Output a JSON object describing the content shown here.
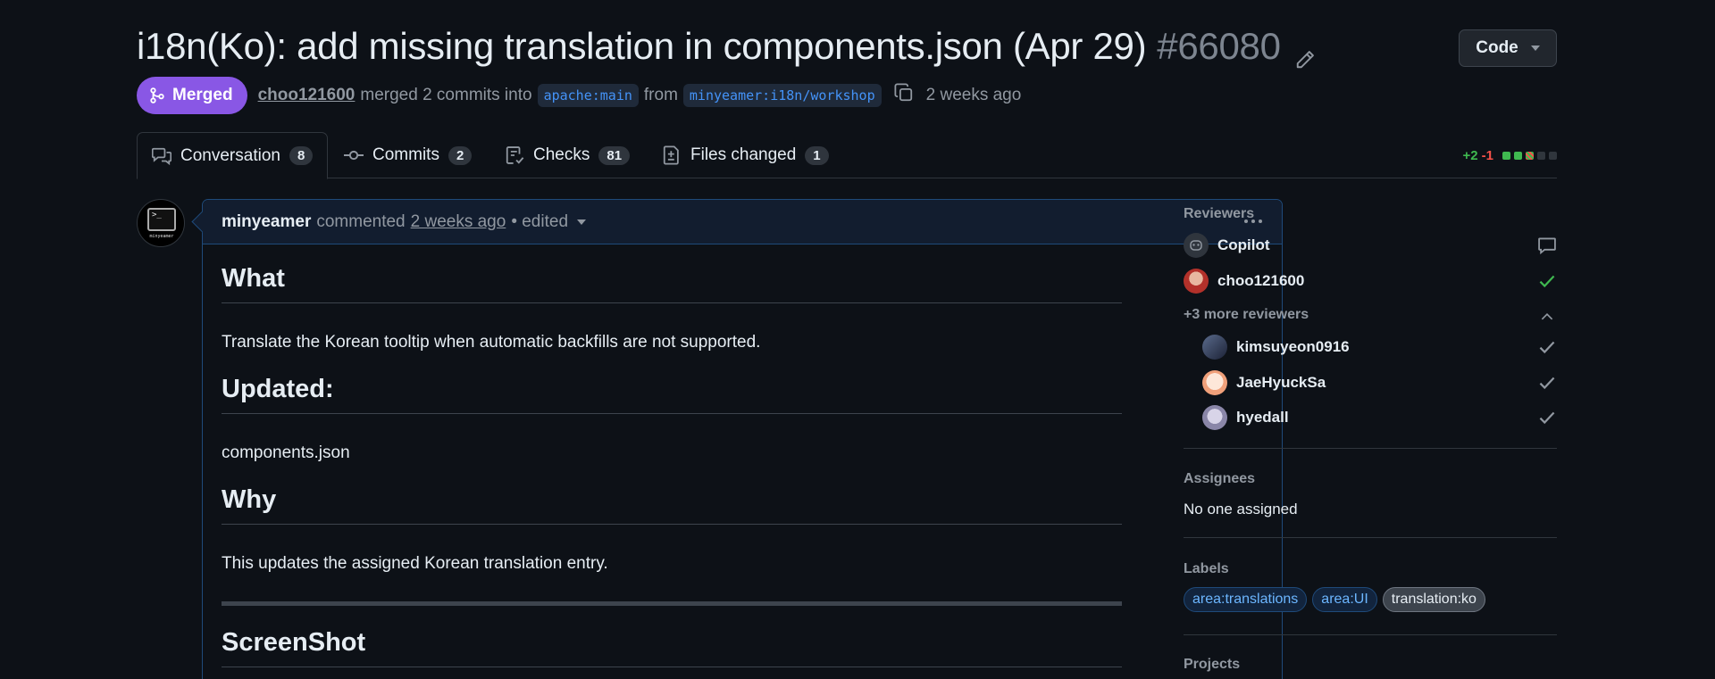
{
  "header": {
    "title": "i18n(Ko): add missing translation in components.json (Apr 29)",
    "number": "#66080",
    "code_button": "Code"
  },
  "meta": {
    "state": "Merged",
    "author": "choo121600",
    "action": "merged 2 commits into",
    "base_branch": "apache:main",
    "from_word": "from",
    "head_branch": "minyeamer:i18n/workshop",
    "time": "2 weeks ago"
  },
  "tabs": [
    {
      "label": "Conversation",
      "count": "8"
    },
    {
      "label": "Commits",
      "count": "2"
    },
    {
      "label": "Checks",
      "count": "81"
    },
    {
      "label": "Files changed",
      "count": "1"
    }
  ],
  "diffstat": {
    "additions": "+2",
    "deletions": "-1"
  },
  "comment": {
    "avatar_caption": "minyeamer",
    "author": "minyeamer",
    "verb": "commented",
    "time": "2 weeks ago",
    "edited": "• edited",
    "sections": [
      {
        "heading": "What",
        "text": "Translate the Korean tooltip when automatic backfills are not supported."
      },
      {
        "heading": "Updated:",
        "text": "components.json"
      },
      {
        "heading": "Why",
        "text": "This updates the assigned Korean translation entry."
      }
    ],
    "last_heading": "ScreenShot"
  },
  "sidebar": {
    "reviewers_label": "Reviewers",
    "reviewers": [
      "Copilot",
      "choo121600"
    ],
    "more_reviewers": "+3 more reviewers",
    "sub_reviewers": [
      "kimsuyeon0916",
      "JaeHyuckSa",
      "hyedall"
    ],
    "assignees_label": "Assignees",
    "assignees_value": "No one assigned",
    "labels_label": "Labels",
    "labels": [
      "area:translations",
      "area:UI",
      "translation:ko"
    ],
    "projects_label": "Projects"
  },
  "colors": {
    "merged": "#8957e5",
    "accent": "#4493f8",
    "success": "#3fb950",
    "danger": "#f85149"
  }
}
